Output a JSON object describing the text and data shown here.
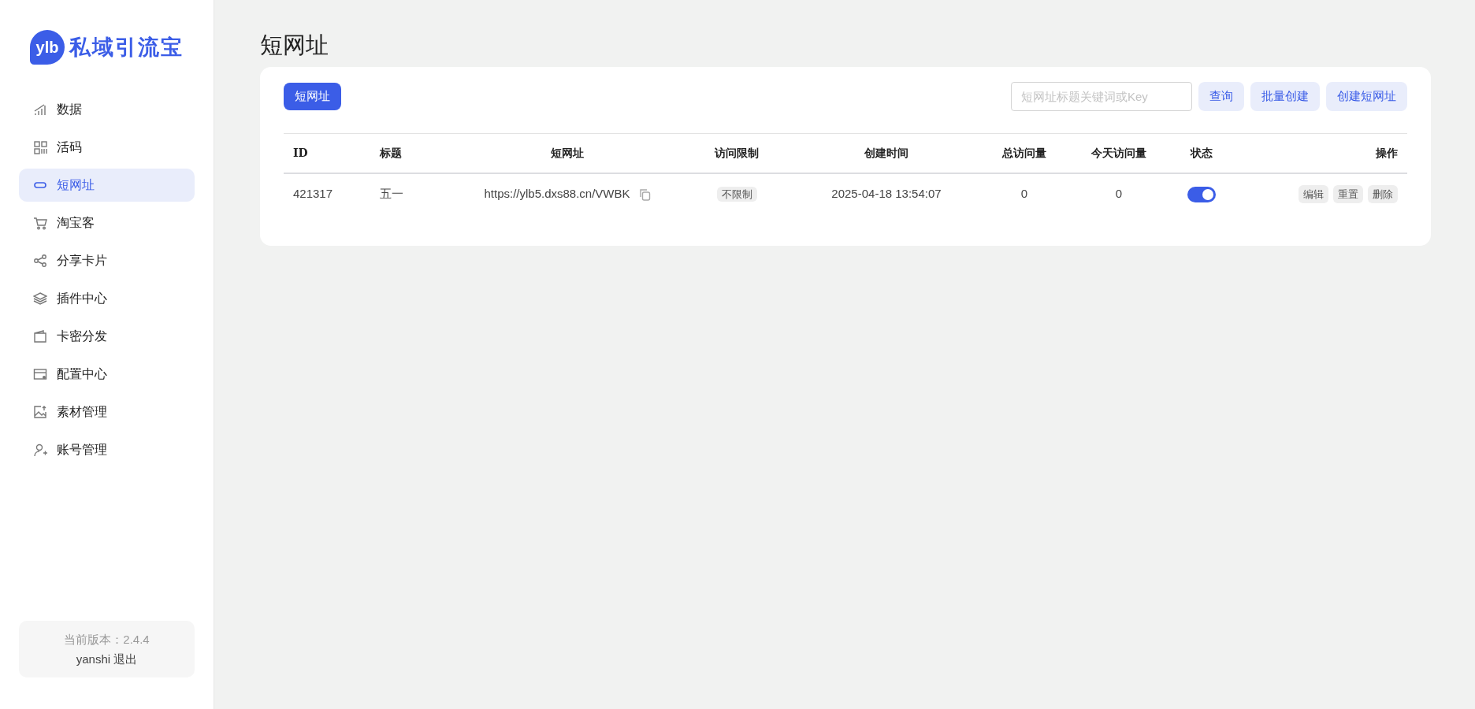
{
  "sidebar": {
    "logo": {
      "mark": "ylb",
      "name": "私域引流宝"
    },
    "items": [
      {
        "label": "数据",
        "selected": false
      },
      {
        "label": "活码",
        "selected": false
      },
      {
        "label": "短网址",
        "selected": true
      },
      {
        "label": "淘宝客",
        "selected": false
      },
      {
        "label": "分享卡片",
        "selected": false
      },
      {
        "label": "插件中心",
        "selected": false
      },
      {
        "label": "卡密分发",
        "selected": false
      },
      {
        "label": "配置中心",
        "selected": false
      },
      {
        "label": "素材管理",
        "selected": false
      },
      {
        "label": "账号管理",
        "selected": false
      }
    ],
    "footer": {
      "version": "当前版本：2.4.4",
      "user": "yanshi",
      "logout": "退出"
    }
  },
  "page_title": "短网址",
  "tabs": [
    {
      "label": "短网址",
      "selected": true
    }
  ],
  "search": {
    "placeholder": "短网址标题关键词或Key"
  },
  "buttons": [
    "查询",
    "批量创建",
    "创建短网址"
  ],
  "table": {
    "columns": [
      "ID",
      "标题",
      "短网址",
      "访问限制",
      "创建时间",
      "总访问量",
      "今天访问量",
      "状态",
      "操作"
    ],
    "rows": [
      {
        "id": "421317",
        "title": "五一",
        "url": "https://ylb5.dxs88.cn/VWBK",
        "limit": "不限制",
        "created": "2025-04-18 13:54:07",
        "total": "0",
        "today": "0",
        "on": true,
        "actions": [
          "编辑",
          "重置",
          "删除"
        ]
      }
    ]
  }
}
